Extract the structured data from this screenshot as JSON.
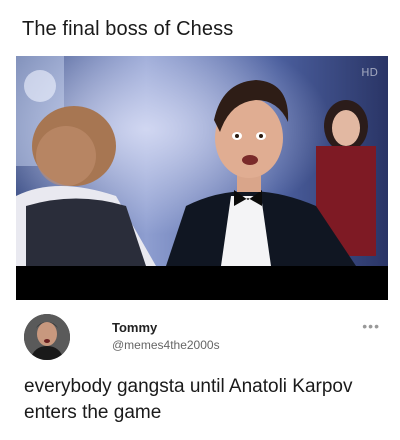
{
  "caption": "The final boss of Chess",
  "video": {
    "watermark": "HD"
  },
  "tweet": {
    "author_name": "Tommy",
    "author_handle": "@memes4the2000s",
    "text": "everybody gangsta until Anatoli Karpov enters the game",
    "more_icon": "more-icon"
  }
}
